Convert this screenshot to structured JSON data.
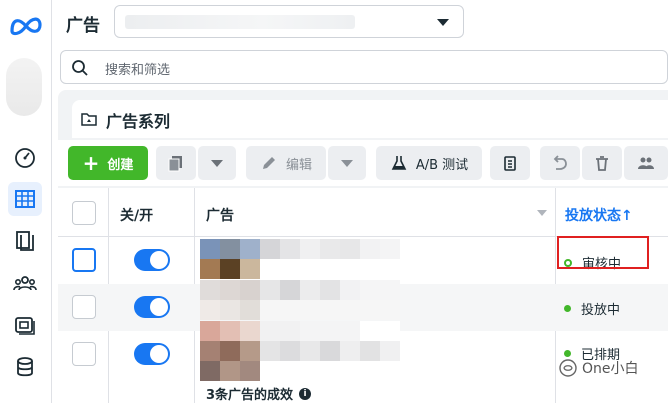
{
  "header": {
    "title": "广告"
  },
  "search": {
    "placeholder": "搜索和筛选"
  },
  "section": {
    "title": "广告系列"
  },
  "toolbar": {
    "create_label": "创建",
    "edit_label": "编辑",
    "ab_test_label": "A/B 测试"
  },
  "table": {
    "columns": {
      "toggle": "关/开",
      "ad": "广告",
      "status": "投放状态"
    },
    "sort_indicator": "↑",
    "rows": [
      {
        "status": "审核中",
        "status_style": "ring"
      },
      {
        "status": "投放中",
        "status_style": "solid"
      },
      {
        "status": "已排期",
        "status_style": "solid"
      }
    ],
    "summary": "3条广告的成效"
  },
  "watermark": {
    "text": "One小白"
  },
  "colors": {
    "accent": "#1877f2",
    "create_green": "#42b72a",
    "highlight_red": "#e02020"
  }
}
